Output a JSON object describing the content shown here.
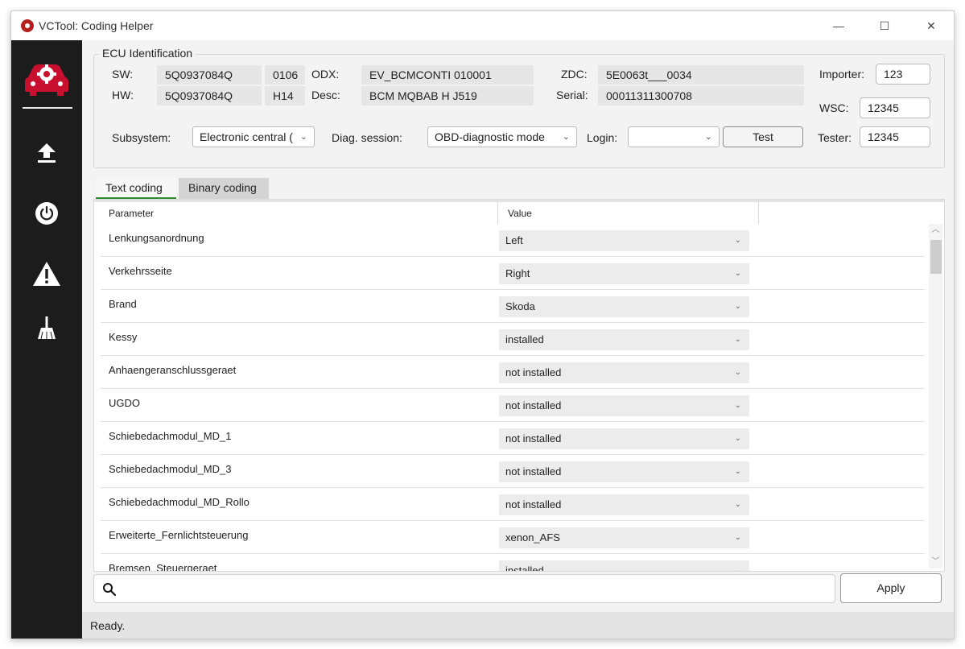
{
  "window": {
    "title": "VCTool: Coding Helper",
    "minimize": "—",
    "maximize": "☐",
    "close": "✕"
  },
  "sidebar": {
    "items": [
      {
        "name": "coding",
        "icon": "car-gear-icon"
      },
      {
        "name": "upload",
        "icon": "upload-icon"
      },
      {
        "name": "power",
        "icon": "power-icon"
      },
      {
        "name": "warning",
        "icon": "warning-icon"
      },
      {
        "name": "clean",
        "icon": "broom-icon"
      }
    ],
    "accent": "#c8102e"
  },
  "ecu": {
    "legend": "ECU Identification",
    "sw_label": "SW:",
    "sw_value": "5Q0937084Q",
    "sw_version": "0106",
    "hw_label": "HW:",
    "hw_value": "5Q0937084Q",
    "hw_version": "H14",
    "odx_label": "ODX:",
    "odx_value": "EV_BCMCONTI 010001",
    "desc_label": "Desc:",
    "desc_value": "BCM MQBAB H   J519",
    "zdc_label": "ZDC:",
    "zdc_value": "5E0063t___0034",
    "serial_label": "Serial:",
    "serial_value": "00011311300708",
    "importer_label": "Importer:",
    "importer_value": "123",
    "wsc_label": "WSC:",
    "wsc_value": "12345",
    "tester_label": "Tester:",
    "tester_value": "12345",
    "subsystem_label": "Subsystem:",
    "subsystem_value": "Electronic central (",
    "diag_label": "Diag. session:",
    "diag_value": "OBD-diagnostic mode",
    "login_label": "Login:",
    "login_value": "",
    "test_button": "Test"
  },
  "tabs": [
    {
      "label": "Text coding",
      "active": true
    },
    {
      "label": "Binary coding",
      "active": false
    }
  ],
  "grid": {
    "columns": [
      "Parameter",
      "Value"
    ],
    "rows": [
      {
        "parameter": "Lenkungsanordnung",
        "value": "Left"
      },
      {
        "parameter": "Verkehrsseite",
        "value": "Right"
      },
      {
        "parameter": "Brand",
        "value": "Skoda"
      },
      {
        "parameter": "Kessy",
        "value": "installed"
      },
      {
        "parameter": "Anhaengeranschlussgeraet",
        "value": "not installed"
      },
      {
        "parameter": "UGDO",
        "value": "not installed"
      },
      {
        "parameter": "Schiebedachmodul_MD_1",
        "value": "not installed"
      },
      {
        "parameter": "Schiebedachmodul_MD_3",
        "value": "not installed"
      },
      {
        "parameter": "Schiebedachmodul_MD_Rollo",
        "value": "not installed"
      },
      {
        "parameter": "Erweiterte_Fernlichtsteuerung",
        "value": "xenon_AFS"
      },
      {
        "parameter": "Bremsen_Steuergeraet",
        "value": "installed"
      }
    ]
  },
  "search": {
    "placeholder": "",
    "icon": "search-icon"
  },
  "apply_button": "Apply",
  "status": "Ready."
}
